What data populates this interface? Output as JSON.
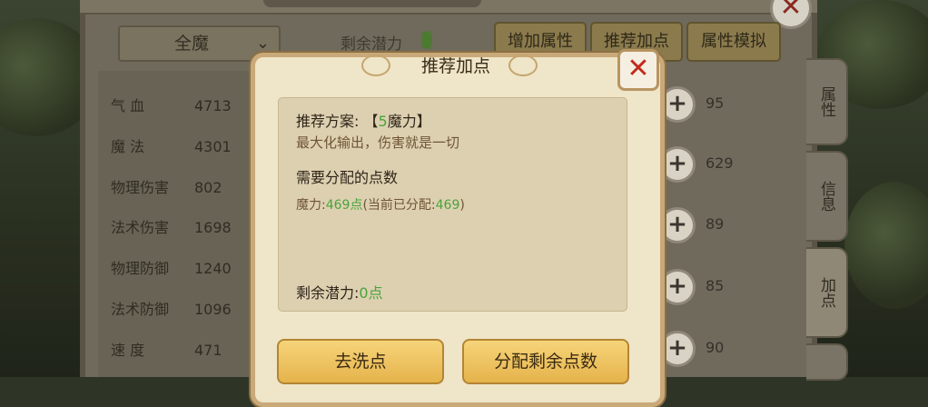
{
  "header": {
    "filter_value": "全魔",
    "potential_label": "剩余潜力",
    "buttons": [
      "增加属性",
      "推荐加点",
      "属性模拟"
    ]
  },
  "stats": [
    {
      "name": "气 血",
      "value": "4713"
    },
    {
      "name": "魔 法",
      "value": "4301"
    },
    {
      "name": "物理伤害",
      "value": "802"
    },
    {
      "name": "法术伤害",
      "value": "1698"
    },
    {
      "name": "物理防御",
      "value": "1240"
    },
    {
      "name": "法术防御",
      "value": "1096"
    },
    {
      "name": "速 度",
      "value": "471"
    }
  ],
  "attr_values": [
    "95",
    "629",
    "89",
    "85",
    "90"
  ],
  "side_tabs": [
    "属性",
    "信息",
    "加点"
  ],
  "dialog": {
    "title": "推荐加点",
    "plan_label": "推荐方案:",
    "plan_value_open": "【",
    "plan_value_num": "5",
    "plan_value_text": "魔力】",
    "plan_desc": "最大化输出，伤害就是一切",
    "need_label": "需要分配的点数",
    "need_line_prefix": "魔力:",
    "need_line_points": "469点",
    "need_line_current_prefix": "(当前已分配:",
    "need_line_current": "469",
    "need_line_suffix": ")",
    "remaining_label": "剩余潜力:",
    "remaining_value": "0点",
    "btn_wash": "去洗点",
    "btn_assign": "分配剩余点数"
  },
  "icons": {
    "close": "close-icon",
    "plus": "plus-icon"
  }
}
